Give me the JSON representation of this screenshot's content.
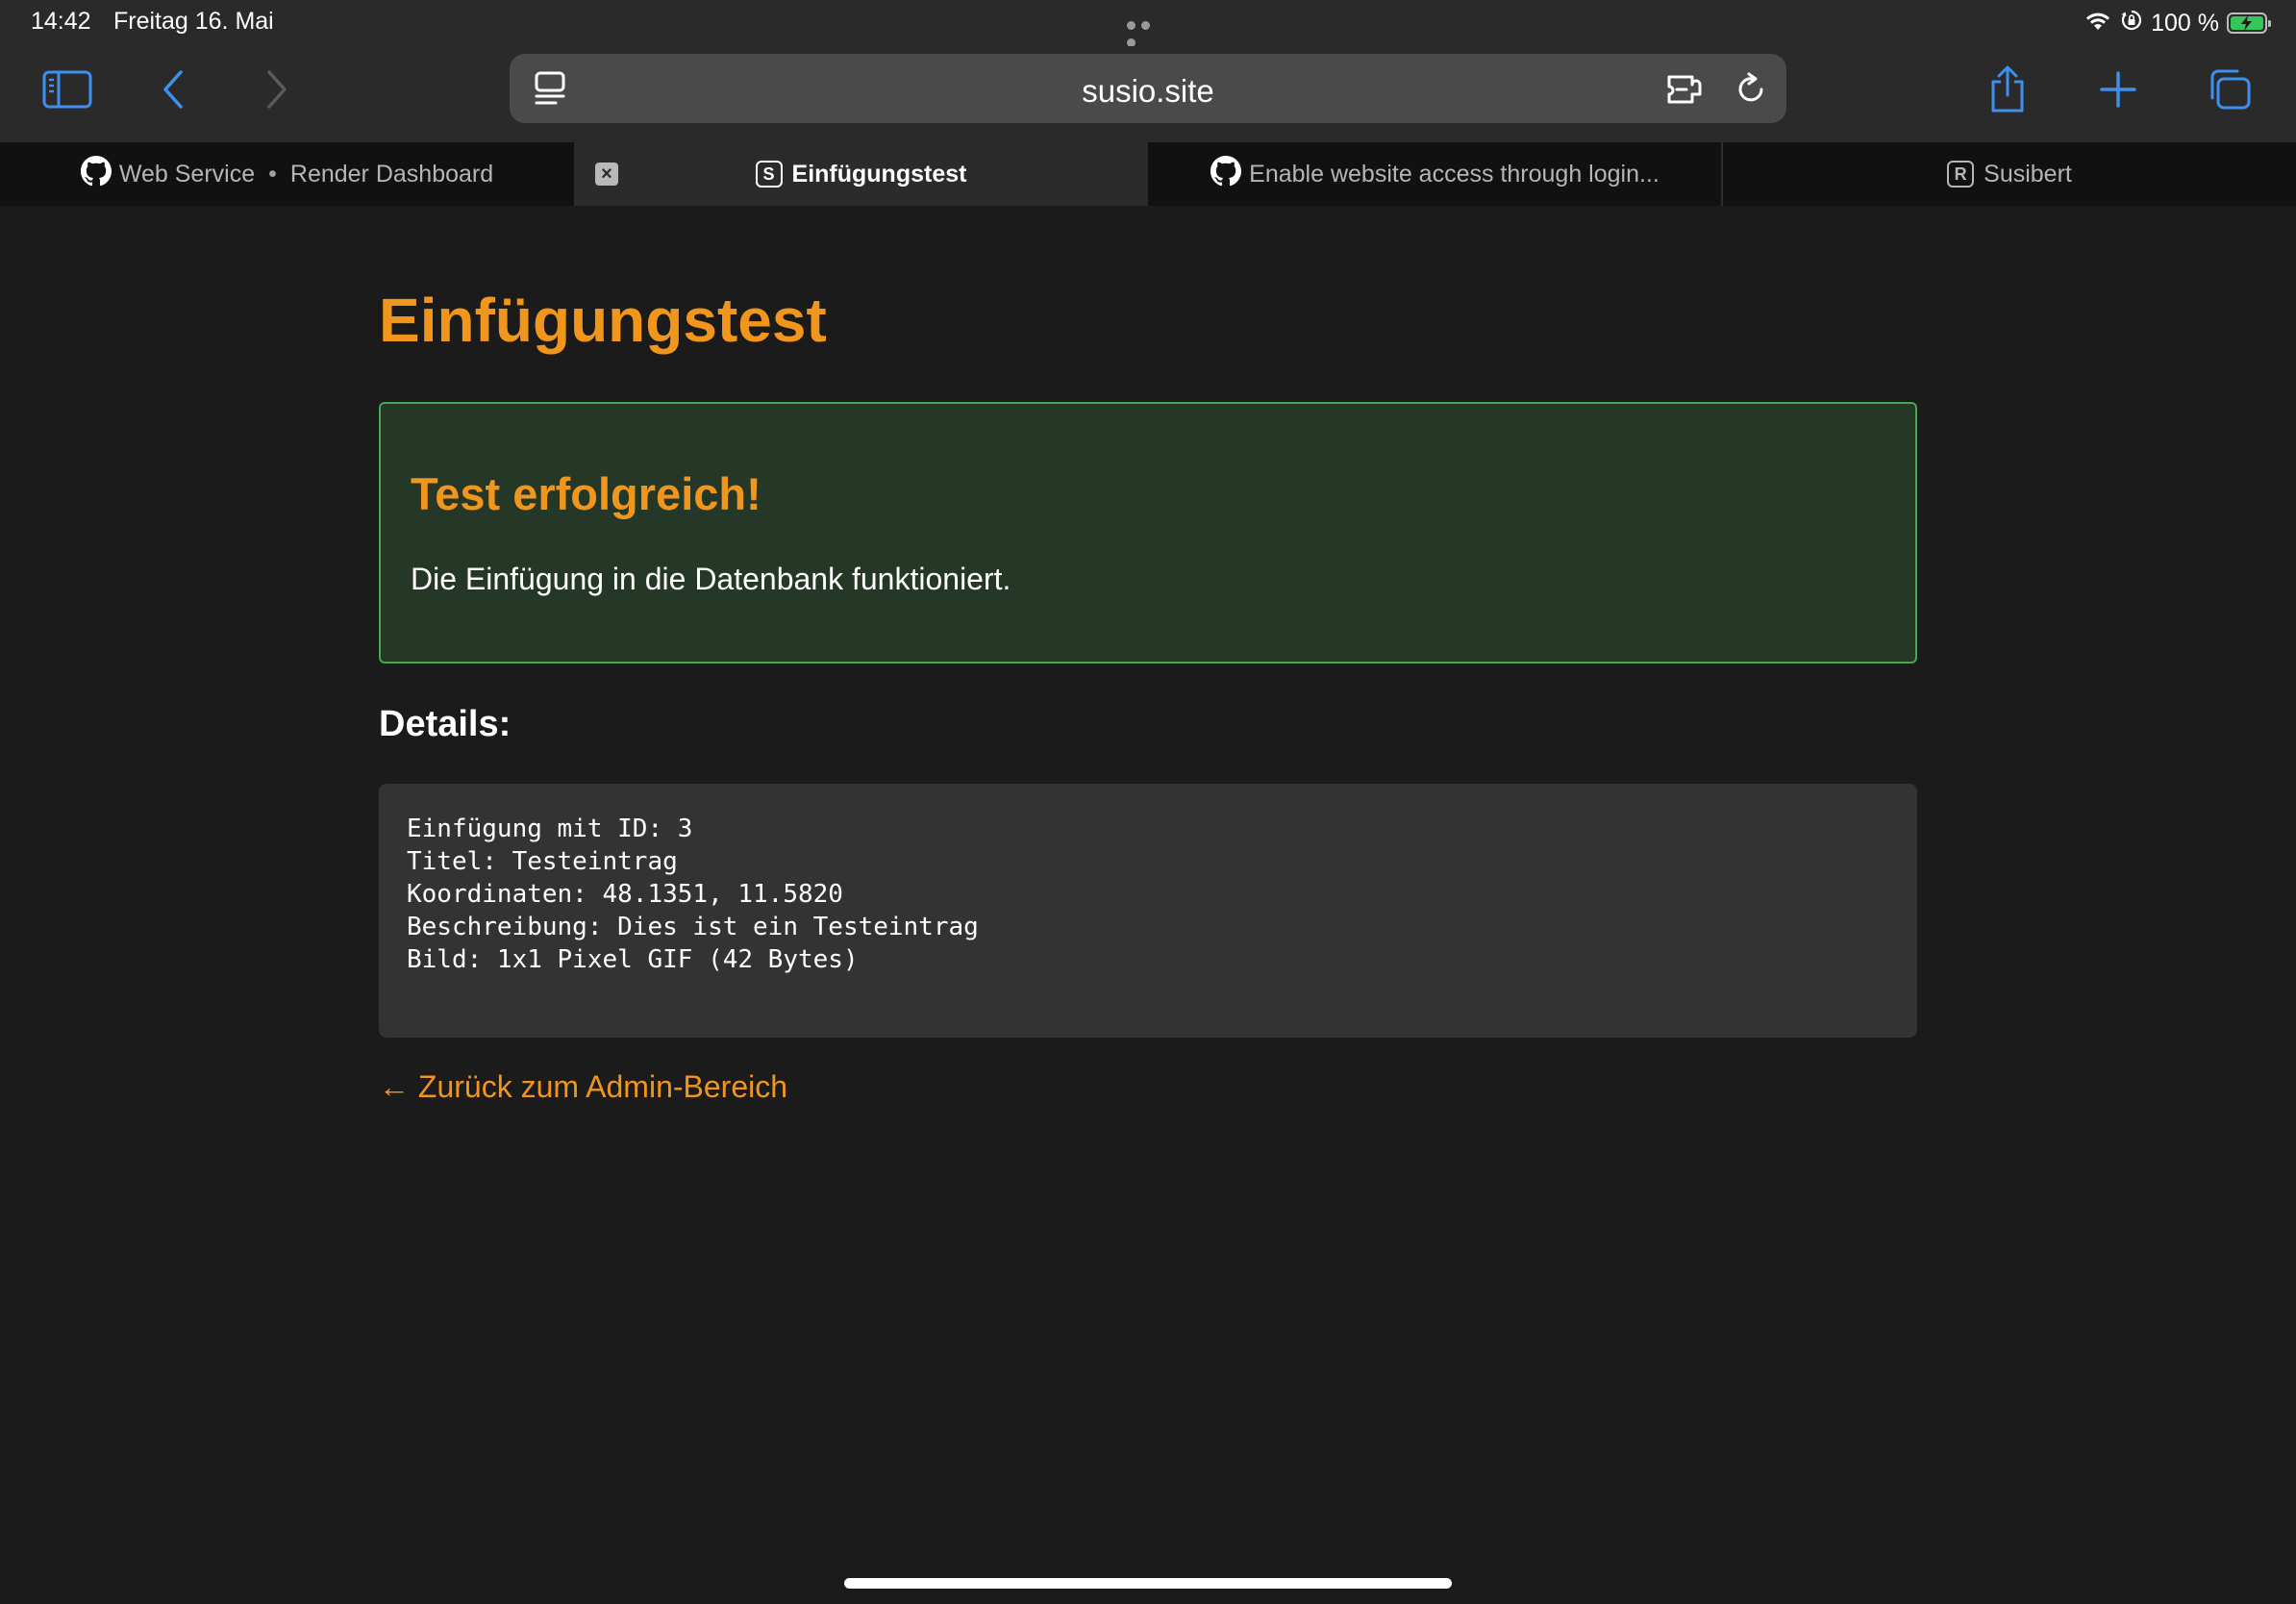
{
  "status_bar": {
    "time": "14:42",
    "date": "Freitag 16. Mai",
    "battery_percent": "100 %",
    "icons": [
      "more-dots-icon",
      "wifi-icon",
      "orientation-lock-icon",
      "battery-charging-icon"
    ]
  },
  "toolbar": {
    "url": "susio.site",
    "icons": [
      "sidebar-icon",
      "back-icon",
      "forward-icon",
      "page-menu-icon",
      "extension-icon",
      "reload-icon",
      "share-icon",
      "new-tab-icon",
      "tab-overview-icon"
    ]
  },
  "tabs": [
    {
      "icon": "github-icon",
      "label_a": "Web Service",
      "separator": "•",
      "label_b": "Render Dashboard",
      "active": false
    },
    {
      "icon": "letter-s-icon",
      "letter": "S",
      "label": "Einfügungstest",
      "active": true
    },
    {
      "icon": "github-icon",
      "label": "Enable website access through login...",
      "active": false
    },
    {
      "icon": "letter-r-icon",
      "letter": "R",
      "label": "Susibert",
      "active": false
    }
  ],
  "page": {
    "title": "Einfügungstest",
    "success": {
      "title": "Test erfolgreich!",
      "message": "Die Einfügung in die Datenbank funktioniert."
    },
    "details_heading": "Details:",
    "details_lines": [
      "Einfügung mit ID: 3",
      "Titel: Testeintrag",
      "Koordinaten: 48.1351, 11.5820",
      "Beschreibung: Dies ist ein Testeintrag",
      "Bild: 1x1 Pixel GIF (42 Bytes)"
    ],
    "back_link": "← Zurück zum Admin-Bereich"
  },
  "colors": {
    "accent": "#f0961c",
    "browser_blue": "#3d8ff0",
    "success_bg": "#253727",
    "success_border": "#45a84a",
    "page_bg": "#1b1b1b",
    "code_bg": "#333333"
  }
}
